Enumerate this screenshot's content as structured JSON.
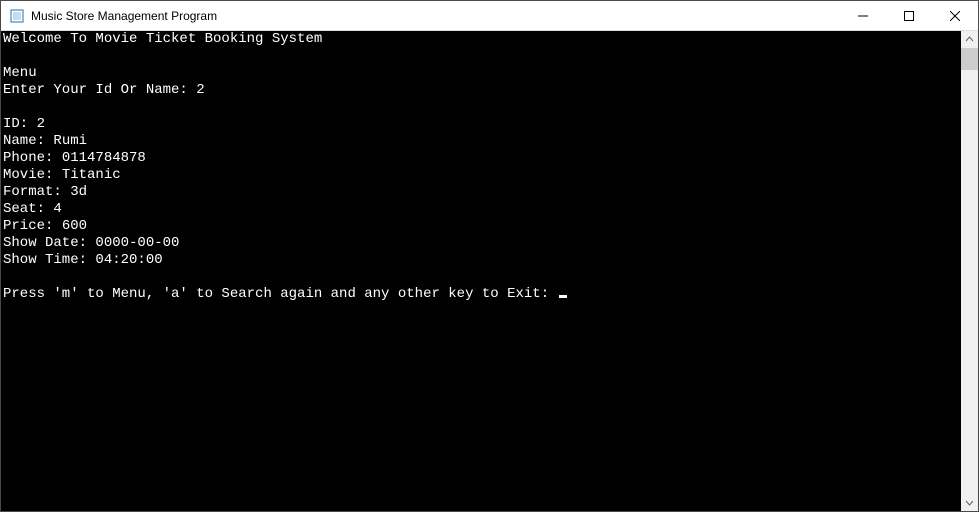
{
  "window": {
    "title": "Music Store Management Program"
  },
  "console": {
    "welcome": "Welcome To Movie Ticket Booking System",
    "menuLabel": "Menu",
    "promptLabel": "Enter Your Id Or Name: ",
    "promptValue": "2",
    "record": {
      "idLabel": "ID: ",
      "idValue": "2",
      "nameLabel": "Name: ",
      "nameValue": "Rumi",
      "phoneLabel": "Phone: ",
      "phoneValue": "0114784878",
      "movieLabel": "Movie: ",
      "movieValue": "Titanic",
      "formatLabel": "Format: ",
      "formatValue": "3d",
      "seatLabel": "Seat: ",
      "seatValue": "4",
      "priceLabel": "Price: ",
      "priceValue": "600",
      "showDateLabel": "Show Date: ",
      "showDateValue": "0000-00-00",
      "showTimeLabel": "Show Time: ",
      "showTimeValue": "04:20:00"
    },
    "footerPrompt": "Press 'm' to Menu, 'a' to Search again and any other key to Exit: "
  }
}
